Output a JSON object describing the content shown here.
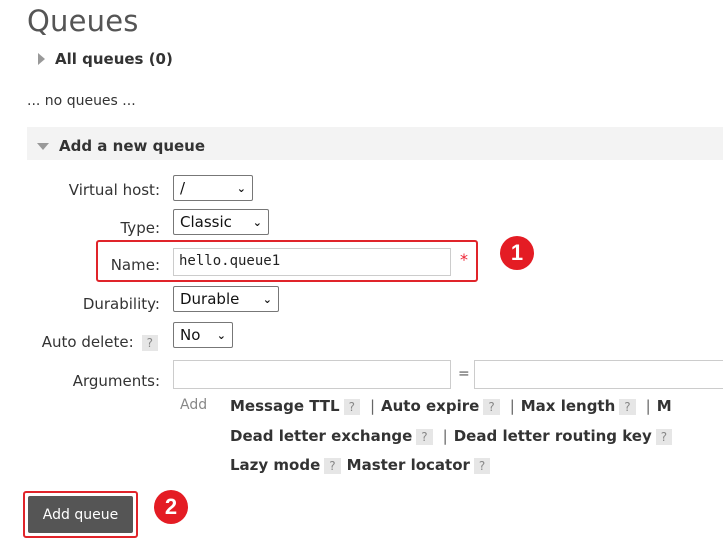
{
  "page": {
    "title": "Queues"
  },
  "all_queues": {
    "label": "All queues (0)",
    "empty_text": "... no queues ..."
  },
  "add_section": {
    "label": "Add a new queue"
  },
  "form": {
    "virtual_host": {
      "label": "Virtual host:",
      "value": "/"
    },
    "type": {
      "label": "Type:",
      "value": "Classic"
    },
    "name": {
      "label": "Name:",
      "value": "hello.queue1",
      "required_mark": "*"
    },
    "durability": {
      "label": "Durability:",
      "value": "Durable"
    },
    "auto_delete": {
      "label": "Auto delete:",
      "help": "?",
      "value": "No"
    },
    "arguments": {
      "label": "Arguments:",
      "equals": "=",
      "add_label": "Add"
    }
  },
  "argument_links": {
    "row1": [
      "Message TTL",
      "Auto expire",
      "Max length"
    ],
    "row1_trailing": "M",
    "row2": [
      "Dead letter exchange",
      "Dead letter routing key"
    ],
    "row3": [
      "Lazy mode",
      "Master locator"
    ],
    "help": "?",
    "separator": "|"
  },
  "buttons": {
    "add_queue": "Add queue"
  },
  "annotations": {
    "badge1": "1",
    "badge2": "2"
  },
  "colors": {
    "highlight": "#e0242a",
    "badge": "#e41c24",
    "button": "#555555"
  },
  "icons": {
    "expand": "triangle-right-icon",
    "collapse": "triangle-down-icon",
    "dropdown": "chevron-down-icon"
  }
}
